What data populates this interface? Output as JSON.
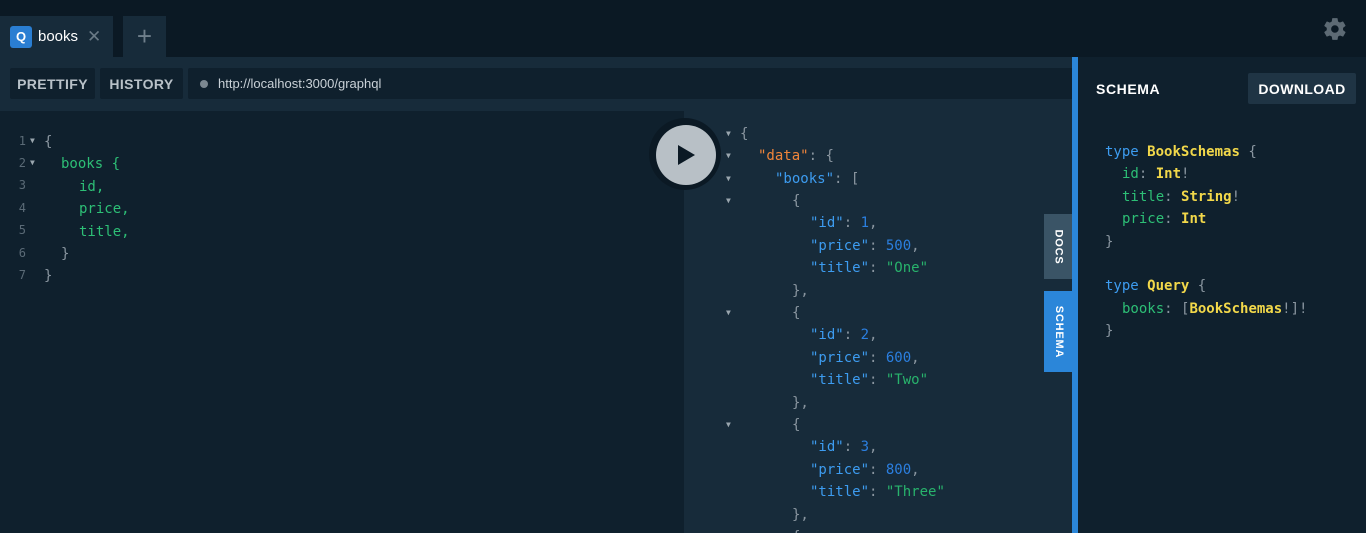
{
  "tabs": [
    {
      "badge": "Q",
      "label": "books",
      "close": "✕"
    }
  ],
  "new_tab_label": "+",
  "toolbar": {
    "prettify_label": "PRETTIFY",
    "history_label": "HISTORY",
    "url": "http://localhost:3000/graphql"
  },
  "editor": {
    "line_numbers": [
      "1",
      "2",
      "3",
      "4",
      "5",
      "6",
      "7"
    ],
    "lines": [
      "{",
      "books {",
      "id,",
      "price,",
      "title,",
      "}",
      "}"
    ]
  },
  "result": {
    "open_brace": "{",
    "data_key": "\"data\"",
    "books_key": "\"books\"",
    "colon": ":",
    "open_bracket": "[",
    "items": [
      {
        "id": "1",
        "price": "500",
        "title": "\"One\""
      },
      {
        "id": "2",
        "price": "600",
        "title": "\"Two\""
      },
      {
        "id": "3",
        "price": "800",
        "title": "\"Three\""
      }
    ],
    "id_key": "\"id\"",
    "price_key": "\"price\"",
    "title_key": "\"title\""
  },
  "side_tabs": {
    "docs": "DOCS",
    "schema": "SCHEMA"
  },
  "schema": {
    "title": "SCHEMA",
    "download_label": "DOWNLOAD",
    "type_keyword": "type",
    "type1_name": "BookSchemas",
    "type1_fields": [
      {
        "name": "id",
        "type": "Int",
        "bang": "!"
      },
      {
        "name": "title",
        "type": "String",
        "bang": "!"
      },
      {
        "name": "price",
        "type": "Int",
        "bang": ""
      }
    ],
    "type2_name": "Query",
    "query_field": "books",
    "query_type": "BookSchemas"
  },
  "colors": {
    "accent": "#2b86d9",
    "background": "#0f202d",
    "panel": "#172b3a",
    "string": "#28b36c",
    "number": "#2b7fe0",
    "data_key": "#f0853a",
    "type_name": "#f2d84a"
  },
  "icons": [
    "query-badge-icon",
    "close-icon",
    "plus-icon",
    "gear-icon",
    "play-icon",
    "fold-arrow-icon"
  ]
}
